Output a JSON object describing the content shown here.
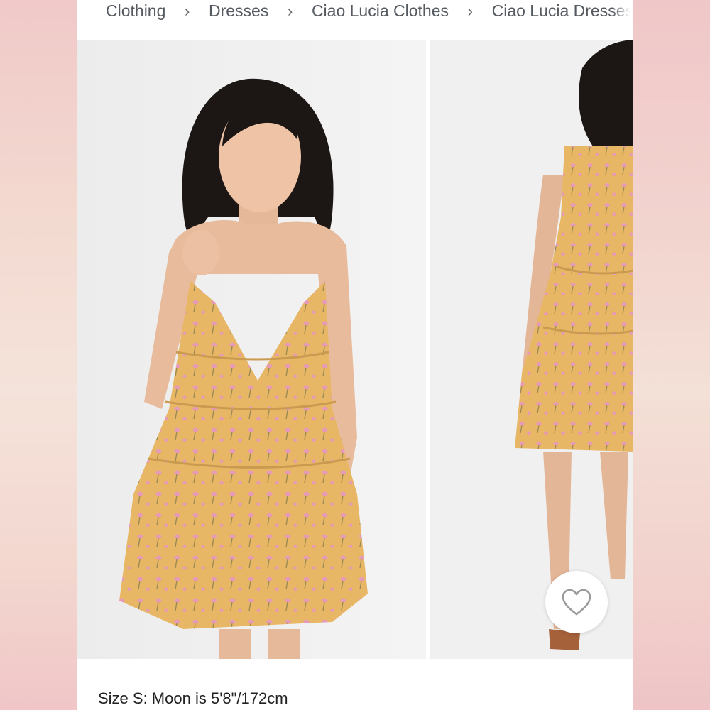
{
  "breadcrumb": {
    "items": [
      "Clothing",
      "Dresses",
      "Ciao Lucia Clothes",
      "Ciao Lucia Dresses"
    ],
    "separator": "›"
  },
  "product_images": [
    {
      "name": "front view"
    },
    {
      "name": "back view"
    }
  ],
  "favorite_button": {
    "icon": "heart-outline-icon"
  },
  "caption": {
    "text": "Size S: Moon is 5'8\"/172cm"
  },
  "colors": {
    "background_pink": "#f0d0cf",
    "dress_yellow": "#e8b765",
    "print_pink": "#e79ab8",
    "hair": "#1c1714"
  }
}
